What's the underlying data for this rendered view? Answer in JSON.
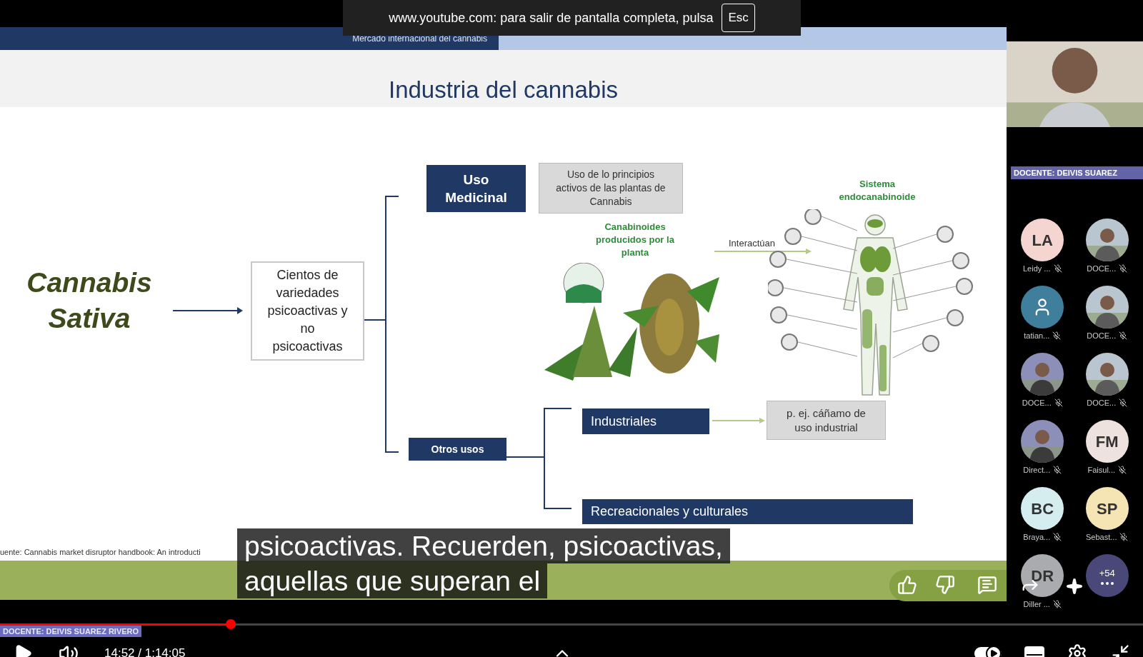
{
  "fullscreen_notice": {
    "text": "www.youtube.com: para salir de pantalla completa, pulsa",
    "key": "Esc"
  },
  "slide": {
    "header": "Mercado internacional del cannabis",
    "title": "Industria del cannabis",
    "subject": "Cannabis Sativa",
    "varieties": "Cientos de variedades psicoactivas y no psicoactivas",
    "medicinal": {
      "label": "Uso Medicinal",
      "description": "Uso de lo principios activos de las plantas de Cannabis",
      "cannabinoids_caption": "Canabinoides producidos por la planta",
      "system_caption": "Sistema endocanabinoide",
      "interaction_label": "Interactúan"
    },
    "other_uses": {
      "label": "Otros usos",
      "items": [
        {
          "label": "Industriales",
          "example": "p. ej. cáñamo de uso industrial"
        },
        {
          "label": "Recreacionales y culturales"
        }
      ]
    },
    "source": "uente: Cannabis market disruptor handbook: An introducti"
  },
  "participants": {
    "presenter_label": "DOCENTE: DEIVIS SUAREZ",
    "rows": [
      {
        "tiles": [
          {
            "kind": "initials",
            "initials": "LA",
            "name": "Leidy ...",
            "color": "#f4d5cf"
          },
          {
            "name": "DOCE..."
          }
        ]
      },
      {
        "tiles": [
          {
            "kind": "icon",
            "name": "tatian...",
            "color": "#3f7f9c"
          },
          {
            "name": "DOCE..."
          }
        ]
      },
      {
        "tiles": [
          {
            "name": "DOCE..."
          },
          {
            "name": "DOCE..."
          }
        ]
      },
      {
        "tiles": [
          {
            "name": "Direct..."
          },
          {
            "kind": "initials",
            "initials": "FM",
            "name": "Faisul...",
            "color": "#eee2df"
          }
        ]
      },
      {
        "tiles": [
          {
            "kind": "initials",
            "initials": "BC",
            "name": "Braya...",
            "color": "#d6edf0"
          },
          {
            "kind": "initials",
            "initials": "SP",
            "name": "Sebast...",
            "color": "#f5e4b4"
          }
        ]
      },
      {
        "tiles": [
          {
            "kind": "initials",
            "initials": "DR",
            "name": "Diller ...",
            "color": "#a9abae"
          },
          {
            "kind": "more",
            "initials": "+54",
            "color": "#4a4878"
          }
        ]
      }
    ]
  },
  "subtitles": [
    "psicoactivas. Recuerden, psicoactivas,",
    "aquellas que superan el"
  ],
  "player": {
    "level": 0.202,
    "time": "14:52 / 1:14:05",
    "overlay_label": "DOCENTE: DEIVIS SUAREZ RIVERO",
    "autoplay": true
  }
}
